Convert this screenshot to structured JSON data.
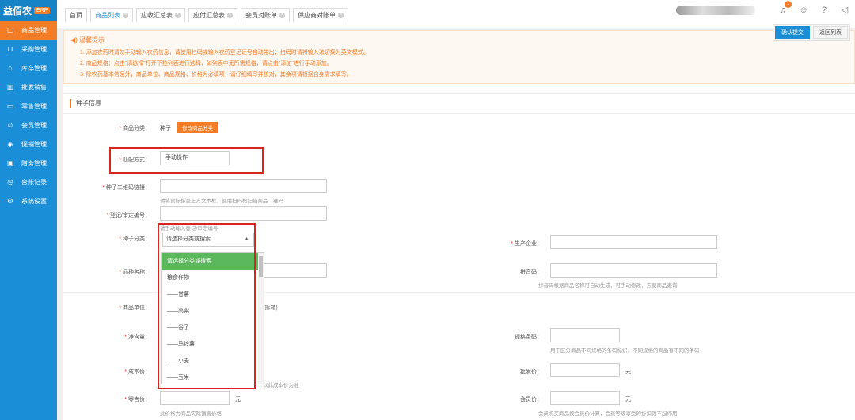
{
  "sidebar": {
    "logo": "益佰农",
    "logo_badge": "ERP",
    "items": [
      {
        "label": "商品管理",
        "icon": "box-icon"
      },
      {
        "label": "采购管理",
        "icon": "cart-icon"
      },
      {
        "label": "库存管理",
        "icon": "warehouse-icon"
      },
      {
        "label": "批发销售",
        "icon": "chart-icon"
      },
      {
        "label": "零售管理",
        "icon": "register-icon"
      },
      {
        "label": "会员管理",
        "icon": "member-icon"
      },
      {
        "label": "促销管理",
        "icon": "tag-icon"
      },
      {
        "label": "财务管理",
        "icon": "finance-icon"
      },
      {
        "label": "台账记录",
        "icon": "clock-icon"
      },
      {
        "label": "系统设置",
        "icon": "gear-icon"
      }
    ]
  },
  "tabs": [
    {
      "label": "首页",
      "closable": false
    },
    {
      "label": "商品列表",
      "closable": true
    },
    {
      "label": "应收汇总表",
      "closable": true
    },
    {
      "label": "应付汇总表",
      "closable": true
    },
    {
      "label": "会员对账单",
      "closable": true
    },
    {
      "label": "供应商对账单",
      "closable": true
    }
  ],
  "topbar": {
    "bell_count": "1"
  },
  "actions": {
    "confirm": "确认提交",
    "back": "返回列表"
  },
  "notice": {
    "title": "温馨提示",
    "lines": [
      "1. 添加农药时请勿手动输入农药信息，请使用扫码或输入农药登记证号自动带出；扫码时请将输入法切换为英文模式。",
      "2. 商品规格：点击\"请选择\"打开下拉列表进行选择，如列表中无所需规格，请点击\"添加\"进行手动添加。",
      "3. 除农药基本信息外，商品单位、商品规格、价格为必填项，请仔细填写并核对，其余项请根据自身需求填写。"
    ]
  },
  "section": {
    "title": "种子信息"
  },
  "form": {
    "category_label": "商品分类：",
    "category_value": "种子",
    "category_button": "修改商品分类",
    "match_label": "匹配方式：",
    "match_value": "手动操作",
    "qrcode_label": "种子二维码链接：",
    "qrcode_hint": "请将鼠标移至上方文本框，使用扫码枪扫描商品二维码",
    "reg_label": "登记/审定编号：",
    "reg_hint": "请手动输入登记/审定编号",
    "type_label": "种子分类：",
    "type_placeholder": "请选择分类或搜索",
    "producer_label": "生产企业：",
    "variety_label": "品种名称：",
    "pinyin_label": "拼音码：",
    "pinyin_hint": "拼音码根据商品名称可自动生成，可手动修改，方便商品查询",
    "unit_label": "商品单位：",
    "unit_note": "(拆箱)",
    "net_label": "净含量：",
    "barcode_label": "规格条码：",
    "barcode_hint": "用于区分商品不同规格的条码标识，不同规格的商品有不同的条码",
    "cost_label": "成本价：",
    "cost_hint": "以此成本价为准",
    "wholesale_label": "批发价：",
    "wholesale_unit": "元",
    "retail_label": "零售价：",
    "retail_unit": "元",
    "retail_hint": "此价格为商品实际销售价格",
    "member_label": "会员价：",
    "member_unit": "元",
    "member_hint": "会员购买商品按会员价计算，会员等级享受的折扣则不起作用"
  },
  "dropdown": {
    "options": [
      "请选择分类或搜索",
      "粮食作物",
      "——甘薯",
      "——高粱",
      "——谷子",
      "——马铃薯",
      "——小麦",
      "——玉米"
    ],
    "selected_index": 0
  },
  "colors": {
    "sidebar": "#1a8fd8",
    "accent": "#f37c27",
    "highlight": "#d9241f",
    "selected": "#5cb85c"
  }
}
